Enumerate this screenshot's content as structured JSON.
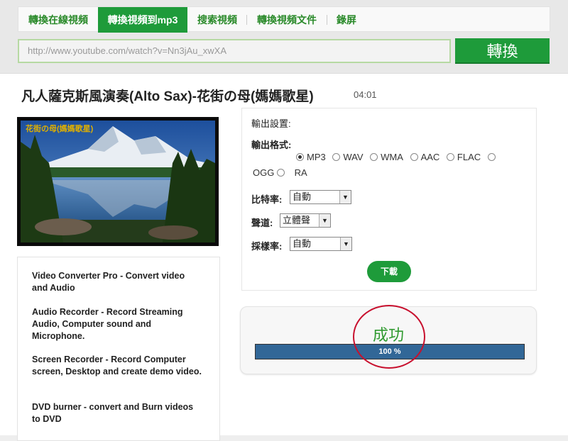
{
  "nav": {
    "items": [
      {
        "label": "轉換在線視頻",
        "active": false
      },
      {
        "label": "轉換視頻到mp3",
        "active": true
      },
      {
        "label": "搜索視頻",
        "active": false
      },
      {
        "label": "轉換視頻文件",
        "active": false
      },
      {
        "label": "錄屏",
        "active": false
      }
    ]
  },
  "url_bar": {
    "value": "http://www.youtube.com/watch?v=Nn3jAu_xwXA",
    "convert_label": "轉換"
  },
  "video": {
    "title": "凡人薩克斯風演奏(Alto Sax)-花街の母(媽媽歌星)",
    "duration": "04:01",
    "thumb_caption": "花街の母(媽媽歌星)"
  },
  "sidebar": {
    "items": [
      "Video Converter Pro - Convert video and Audio",
      "Audio Recorder - Record Streaming Audio, Computer sound and Microphone.",
      "Screen Recorder - Record Computer screen, Desktop and create demo video.",
      "DVD burner - convert and Burn videos to DVD"
    ]
  },
  "settings": {
    "heading": "輸出設置:",
    "format_label": "輸出格式:",
    "formats": [
      "MP3",
      "WAV",
      "WMA",
      "AAC",
      "FLAC",
      "OGG",
      "RA"
    ],
    "selected_format": "MP3",
    "bitrate_label": "比特率:",
    "bitrate_value": "自動",
    "channel_label": "聲道:",
    "channel_value": "立體聲",
    "samplerate_label": "採樣率:",
    "samplerate_value": "自動",
    "download_label": "下載"
  },
  "progress": {
    "status": "成功",
    "percent": 100,
    "percent_label": "100 %"
  },
  "colors": {
    "brand_green": "#1e9b3a",
    "progress_fill": "#326797",
    "annotation_red": "#c8102e"
  }
}
